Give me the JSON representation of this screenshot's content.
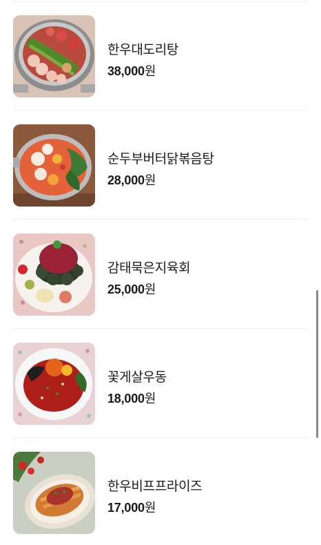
{
  "menu": {
    "items": [
      {
        "name": "한우대도리탕",
        "price": "38,000",
        "currency": "원",
        "image": "beef-hotpot-with-chives"
      },
      {
        "name": "순두부버터닭볶음탕",
        "price": "28,000",
        "currency": "원",
        "image": "spicy-chicken-tofu-stew"
      },
      {
        "name": "감태묵은지육회",
        "price": "25,000",
        "currency": "원",
        "image": "beef-tartare-seaweed-rolls"
      },
      {
        "name": "꽃게살우동",
        "price": "18,000",
        "currency": "원",
        "image": "spicy-crab-udon"
      },
      {
        "name": "한우비프프라이즈",
        "price": "17,000",
        "currency": "원",
        "image": "beef-fries-platter"
      }
    ]
  }
}
